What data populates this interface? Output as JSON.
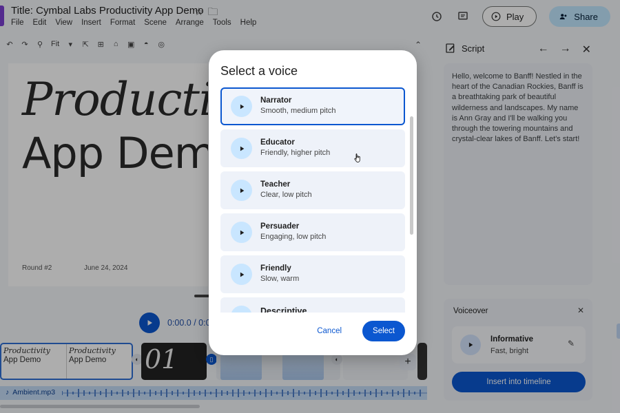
{
  "app": {
    "title": "Title: Cymbal Labs Productivity App Demo",
    "menu": [
      "File",
      "Edit",
      "View",
      "Insert",
      "Format",
      "Scene",
      "Arrange",
      "Tools",
      "Help"
    ],
    "play_label": "Play",
    "share_label": "Share",
    "zoom_label": "Fit"
  },
  "slide": {
    "heading_line1": "Productivity",
    "heading_line2": "App Demo",
    "round_label": "Round #2",
    "date_label": "June 24, 2024"
  },
  "player": {
    "time": "0:00.0 / 0:0"
  },
  "filmstrip": {
    "clip1_line1": "Productivity",
    "clip1_line2": "App Demo",
    "clip2_text": "01"
  },
  "audio": {
    "file_name": "Ambient.mp3"
  },
  "script_panel": {
    "title": "Script",
    "text": "Hello, welcome to Banff! Nestled in the heart of the Canadian Rockies, Banff is a breathtaking park of beautiful wilderness and landscapes. My name is Ann Gray and I'll be walking you through the towering mountains and crystal-clear lakes of Banff. Let's start!"
  },
  "voiceover": {
    "title": "Voiceover",
    "voice_name": "Informative",
    "voice_desc": "Fast, bright",
    "insert_label": "Insert into timeline"
  },
  "dialog": {
    "title": "Select a voice",
    "voices": [
      {
        "name": "Narrator",
        "desc": "Smooth, medium pitch",
        "selected": true
      },
      {
        "name": "Educator",
        "desc": "Friendly, higher pitch",
        "selected": false
      },
      {
        "name": "Teacher",
        "desc": "Clear, low pitch",
        "selected": false
      },
      {
        "name": "Persuader",
        "desc": "Engaging, low pitch",
        "selected": false
      },
      {
        "name": "Friendly",
        "desc": "Slow, warm",
        "selected": false
      },
      {
        "name": "Descriptive",
        "desc": "",
        "selected": false
      }
    ],
    "cancel_label": "Cancel",
    "select_label": "Select"
  },
  "colors": {
    "accent": "#0b57d0",
    "play_chip": "#c9e6ff",
    "item_bg": "#eef2f9"
  }
}
